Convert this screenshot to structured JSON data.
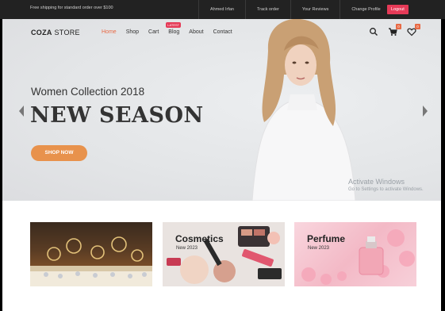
{
  "topbar": {
    "shipping": "Free shipping for standard order over $100",
    "links": [
      "Ahmed Irfan",
      "Track order",
      "Your Reviews",
      "Change Profile"
    ],
    "logout": "Logout"
  },
  "header": {
    "brand_bold": "COZA",
    "brand_rest": " STORE",
    "nav": [
      {
        "label": "Home",
        "active": true
      },
      {
        "label": "Shop"
      },
      {
        "label": "Cart"
      },
      {
        "label": "Blog",
        "badge": "LATEST"
      },
      {
        "label": "About"
      },
      {
        "label": "Contact"
      }
    ],
    "cart_count": "0",
    "wishlist_count": "0",
    "icons": [
      "search-icon",
      "cart-icon",
      "heart-icon"
    ]
  },
  "hero": {
    "subtitle": "Women Collection 2018",
    "title": "NEW SEASON",
    "button": "SHOP NOW"
  },
  "watermark": {
    "line1": "Activate Windows",
    "line2": "Go to Settings to activate Windows."
  },
  "categories": [
    {
      "title": "",
      "sub": ""
    },
    {
      "title": "Cosmetics",
      "sub": "New 2023"
    },
    {
      "title": "Perfume",
      "sub": "New 2023"
    }
  ],
  "colors": {
    "accent": "#e8924c",
    "logout": "#e53a57",
    "topbar": "#222222"
  }
}
